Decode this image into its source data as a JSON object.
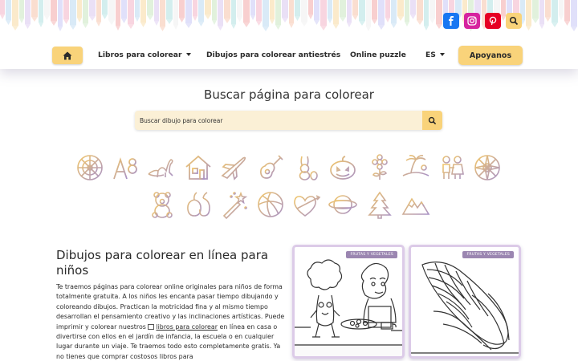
{
  "header": {
    "social": [
      {
        "name": "facebook-icon",
        "color": "#1877f2",
        "glyph": "f"
      },
      {
        "name": "instagram-icon",
        "color": "#d6249f"
      },
      {
        "name": "pinterest-icon",
        "color": "#e60023",
        "glyph": "P"
      }
    ],
    "search_icon_color": "#f9d37a"
  },
  "nav": {
    "books": "Libros para colorear",
    "antistress": "Dibujos para colorear antiestrés",
    "puzzle": "Online puzzle",
    "lang": "ES",
    "support": "Apoyanos"
  },
  "search": {
    "title": "Buscar página para colorear",
    "placeholder": "Buscar dibujo para colorear"
  },
  "categories": [
    "mandala-icon",
    "letters-icon",
    "dinosaur-icon",
    "house-icon",
    "airplane-icon",
    "guitar-icon",
    "easter-bunny-icon",
    "pumpkin-icon",
    "flower-icon",
    "island-icon",
    "couple-icon",
    "mandala-circle-icon",
    "teddy-bear-icon",
    "fruits-vegetables-icon",
    "magic-wand-icon",
    "ball-icon",
    "hearts-icon",
    "planet-icon",
    "christmas-tree-icon",
    "mountains-icon"
  ],
  "content": {
    "title": "Dibujos para colorear en línea para niños",
    "p1": "Te traemos páginas para colorear online originales para niños de forma totalmente gratuita. A los niños les encanta pasar tiempo dibujando y coloreando dibujos. Practican la motricidad fina y al mismo tiempo desarrollan el pensamiento creativo y las inclinaciones artísticas. Puede imprimir y colorear nuestros ",
    "link": "libros para colorear",
    "p2": " en línea en casa o divertirse con ellos en el jardín de infancia, la escuela o en cualquier lugar durante un viaje. Te traemos todo esto completamente gratis. Ya no tienes que comprar costosos libros para"
  },
  "cards": [
    {
      "badge": "FRUTAS Y VEGETALES"
    },
    {
      "badge": "FRUTAS Y VEGETALES"
    }
  ],
  "colors": {
    "accent": "#f9d37a",
    "icon_gradient_a": "#f2c76a",
    "icon_gradient_b": "#a892c6"
  }
}
